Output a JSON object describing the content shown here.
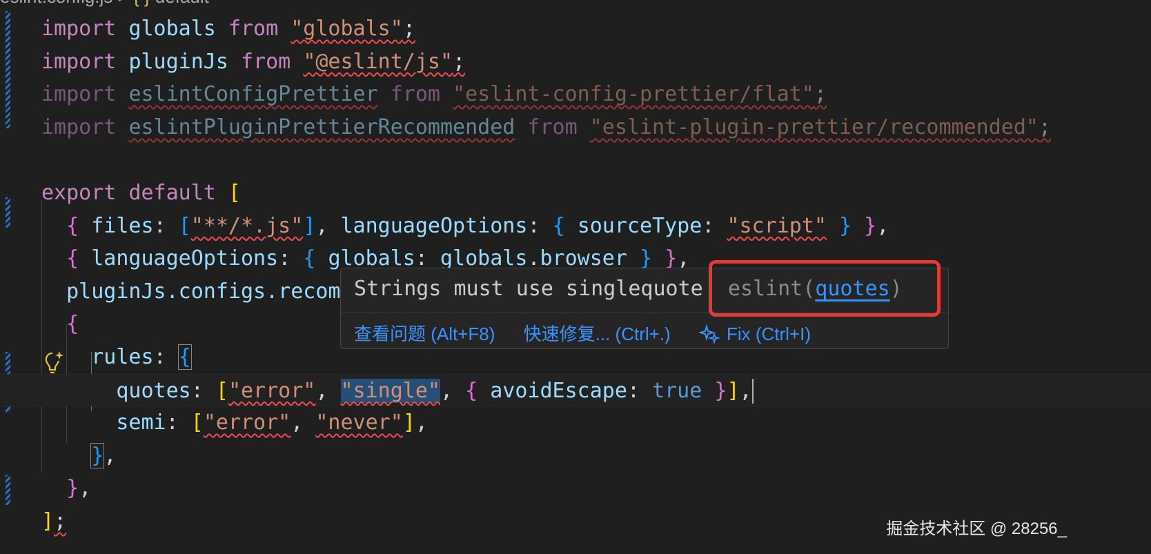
{
  "breadcrumb": {
    "file": "eslint.config.js",
    "separator": ">",
    "symbol_icon": "{ }",
    "symbol": "default"
  },
  "code": {
    "l1": {
      "kw1": "import",
      "name": "globals",
      "kw2": "from",
      "src": "\"globals\"",
      "end": ";"
    },
    "l2": {
      "kw1": "import",
      "name": "pluginJs",
      "kw2": "from",
      "src": "\"@eslint/js\"",
      "end": ";"
    },
    "l3": {
      "kw1": "import",
      "name": "eslintConfigPrettier",
      "kw2": "from",
      "src": "\"eslint-config-prettier/flat\"",
      "end": ";"
    },
    "l4": {
      "kw1": "import",
      "name": "eslintPluginPrettierRecommended",
      "kw2": "from",
      "src": "\"eslint-plugin-prettier/recommended\"",
      "end": ";"
    },
    "l6": {
      "kw1": "export",
      "kw2": "default",
      "open": "["
    },
    "l7": {
      "b": "{",
      "key1": "files",
      "arr_open": "[",
      "glob": "\"**/*.js\"",
      "arr_close": "]",
      "key2": "languageOptions",
      "b2": "{",
      "key3": "sourceType",
      "val": "\"script\"",
      "b2c": "}",
      "bc": "}",
      "comma": ","
    },
    "l8": {
      "b": "{",
      "key1": "languageOptions",
      "b2": "{",
      "key2": "globals",
      "obj": "globals",
      "prop": "browser",
      "b2c": "}",
      "bc": "}",
      "comma": ","
    },
    "l9": {
      "text": "pluginJs.configs.recom"
    },
    "l10": {
      "b": "{"
    },
    "l11": {
      "key": "rules",
      "b": "{"
    },
    "l12": {
      "key": "quotes",
      "arr_open": "[",
      "v1": "\"error\"",
      "v2": "\"single\"",
      "b": "{",
      "opt": "avoidEscape",
      "bool": "true",
      "bc": "}",
      "arr_close": "]",
      "comma": ","
    },
    "l13": {
      "key": "semi",
      "arr_open": "[",
      "v1": "\"error\"",
      "v2": "\"never\"",
      "arr_close": "]",
      "comma": ","
    },
    "l14": {
      "b": "}",
      "comma": ","
    },
    "l15": {
      "b": "}",
      "comma": ","
    },
    "l16": {
      "b": "]",
      "end": ";"
    }
  },
  "hover": {
    "message": "Strings must use singlequote",
    "source": "eslint(",
    "rule": "quotes",
    "source_end": ")",
    "actions": {
      "view_problem": "查看问题 (Alt+F8)",
      "quick_fix": "快速修复... (Ctrl+.)",
      "fix": "Fix (Ctrl+I)"
    }
  },
  "watermark": "掘金技术社区 @ 28256_",
  "colors": {
    "background": "#1f1f1f",
    "keyword": "#c586c0",
    "identifier": "#9cdcfe",
    "string": "#ce9178",
    "error_squiggle": "#f14c4c",
    "link": "#3794ff",
    "annotation_box": "#e53935"
  },
  "icons": {
    "lightbulb": "lightbulb-sparkle-icon",
    "fix": "sparkle-icon"
  }
}
